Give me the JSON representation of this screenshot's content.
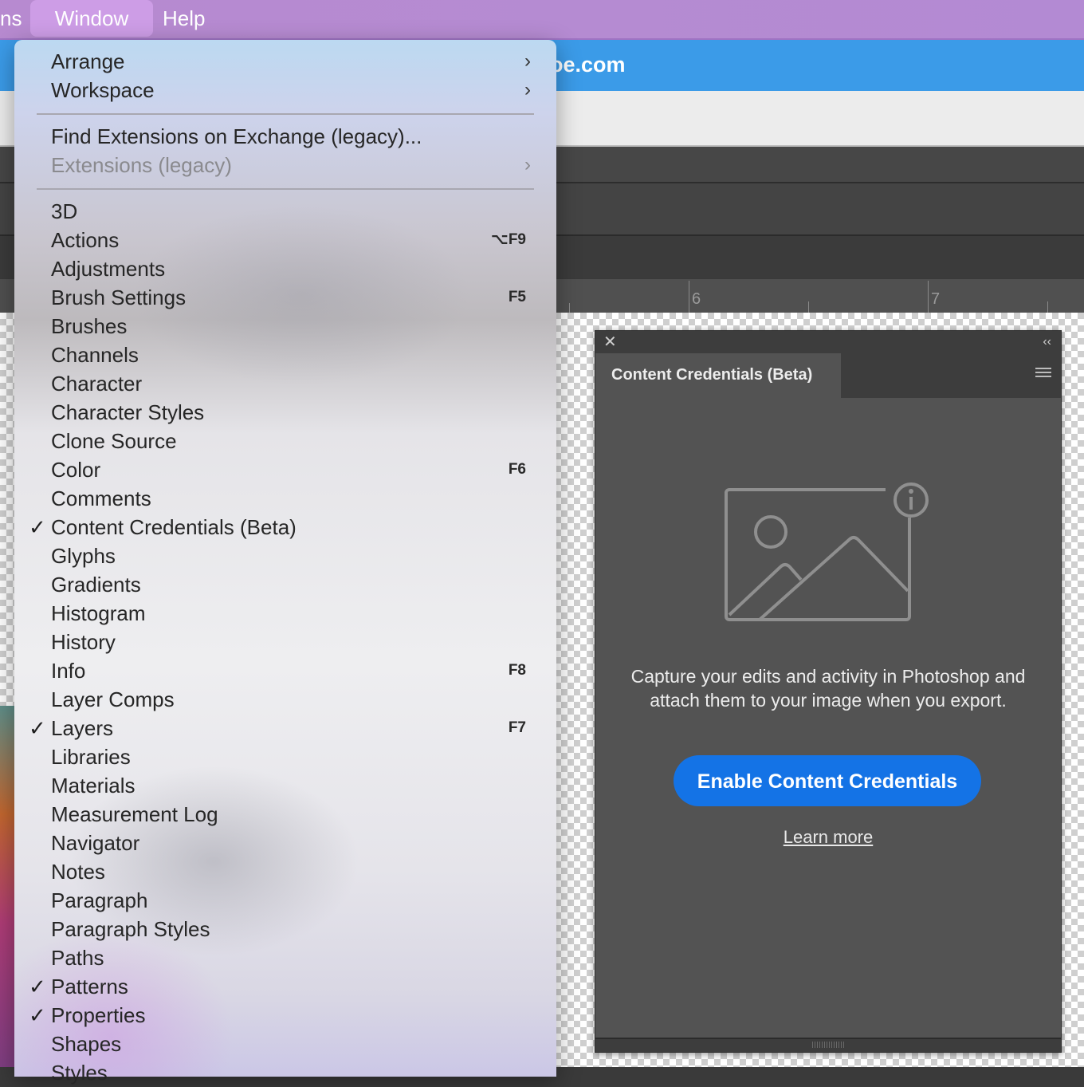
{
  "menubar": {
    "items": [
      {
        "label": "ns",
        "active": false
      },
      {
        "label": "Window",
        "active": true
      },
      {
        "label": "Help",
        "active": false
      }
    ]
  },
  "background": {
    "url_text": "oe.com",
    "ruler": [
      "6",
      "7"
    ]
  },
  "window_menu": {
    "items": [
      {
        "label": "Arrange",
        "submenu": true,
        "checked": false,
        "shortcut": "",
        "disabled": false
      },
      {
        "label": "Workspace",
        "submenu": true,
        "checked": false,
        "shortcut": "",
        "disabled": false
      },
      {
        "label": "Find Extensions on Exchange (legacy)...",
        "submenu": false,
        "checked": false,
        "shortcut": "",
        "disabled": false
      },
      {
        "label": "Extensions (legacy)",
        "submenu": true,
        "checked": false,
        "shortcut": "",
        "disabled": true
      },
      {
        "label": "3D",
        "submenu": false,
        "checked": false,
        "shortcut": "",
        "disabled": false
      },
      {
        "label": "Actions",
        "submenu": false,
        "checked": false,
        "shortcut": "⌥F9",
        "disabled": false
      },
      {
        "label": "Adjustments",
        "submenu": false,
        "checked": false,
        "shortcut": "",
        "disabled": false
      },
      {
        "label": "Brush Settings",
        "submenu": false,
        "checked": false,
        "shortcut": "F5",
        "disabled": false
      },
      {
        "label": "Brushes",
        "submenu": false,
        "checked": false,
        "shortcut": "",
        "disabled": false
      },
      {
        "label": "Channels",
        "submenu": false,
        "checked": false,
        "shortcut": "",
        "disabled": false
      },
      {
        "label": "Character",
        "submenu": false,
        "checked": false,
        "shortcut": "",
        "disabled": false
      },
      {
        "label": "Character Styles",
        "submenu": false,
        "checked": false,
        "shortcut": "",
        "disabled": false
      },
      {
        "label": "Clone Source",
        "submenu": false,
        "checked": false,
        "shortcut": "",
        "disabled": false
      },
      {
        "label": "Color",
        "submenu": false,
        "checked": false,
        "shortcut": "F6",
        "disabled": false
      },
      {
        "label": "Comments",
        "submenu": false,
        "checked": false,
        "shortcut": "",
        "disabled": false
      },
      {
        "label": "Content Credentials (Beta)",
        "submenu": false,
        "checked": true,
        "shortcut": "",
        "disabled": false
      },
      {
        "label": "Glyphs",
        "submenu": false,
        "checked": false,
        "shortcut": "",
        "disabled": false
      },
      {
        "label": "Gradients",
        "submenu": false,
        "checked": false,
        "shortcut": "",
        "disabled": false
      },
      {
        "label": "Histogram",
        "submenu": false,
        "checked": false,
        "shortcut": "",
        "disabled": false
      },
      {
        "label": "History",
        "submenu": false,
        "checked": false,
        "shortcut": "",
        "disabled": false
      },
      {
        "label": "Info",
        "submenu": false,
        "checked": false,
        "shortcut": "F8",
        "disabled": false
      },
      {
        "label": "Layer Comps",
        "submenu": false,
        "checked": false,
        "shortcut": "",
        "disabled": false
      },
      {
        "label": "Layers",
        "submenu": false,
        "checked": true,
        "shortcut": "F7",
        "disabled": false
      },
      {
        "label": "Libraries",
        "submenu": false,
        "checked": false,
        "shortcut": "",
        "disabled": false
      },
      {
        "label": "Materials",
        "submenu": false,
        "checked": false,
        "shortcut": "",
        "disabled": false
      },
      {
        "label": "Measurement Log",
        "submenu": false,
        "checked": false,
        "shortcut": "",
        "disabled": false
      },
      {
        "label": "Navigator",
        "submenu": false,
        "checked": false,
        "shortcut": "",
        "disabled": false
      },
      {
        "label": "Notes",
        "submenu": false,
        "checked": false,
        "shortcut": "",
        "disabled": false
      },
      {
        "label": "Paragraph",
        "submenu": false,
        "checked": false,
        "shortcut": "",
        "disabled": false
      },
      {
        "label": "Paragraph Styles",
        "submenu": false,
        "checked": false,
        "shortcut": "",
        "disabled": false
      },
      {
        "label": "Paths",
        "submenu": false,
        "checked": false,
        "shortcut": "",
        "disabled": false
      },
      {
        "label": "Patterns",
        "submenu": false,
        "checked": true,
        "shortcut": "",
        "disabled": false
      },
      {
        "label": "Properties",
        "submenu": false,
        "checked": true,
        "shortcut": "",
        "disabled": false
      },
      {
        "label": "Shapes",
        "submenu": false,
        "checked": false,
        "shortcut": "",
        "disabled": false
      },
      {
        "label": "Styles",
        "submenu": false,
        "checked": false,
        "shortcut": "",
        "disabled": false
      }
    ],
    "check_glyph": "✓",
    "submenu_glyph": "›"
  },
  "panel": {
    "close_glyph": "✕",
    "collapse_glyph": "‹‹",
    "tab_label": "Content Credentials (Beta)",
    "description": "Capture your edits and activity in Photoshop and attach them to your image when you export.",
    "enable_button": "Enable Content Credentials",
    "learn_more": "Learn more",
    "illustration_icon": "image-info-icon",
    "accent_color": "#1473e6"
  }
}
